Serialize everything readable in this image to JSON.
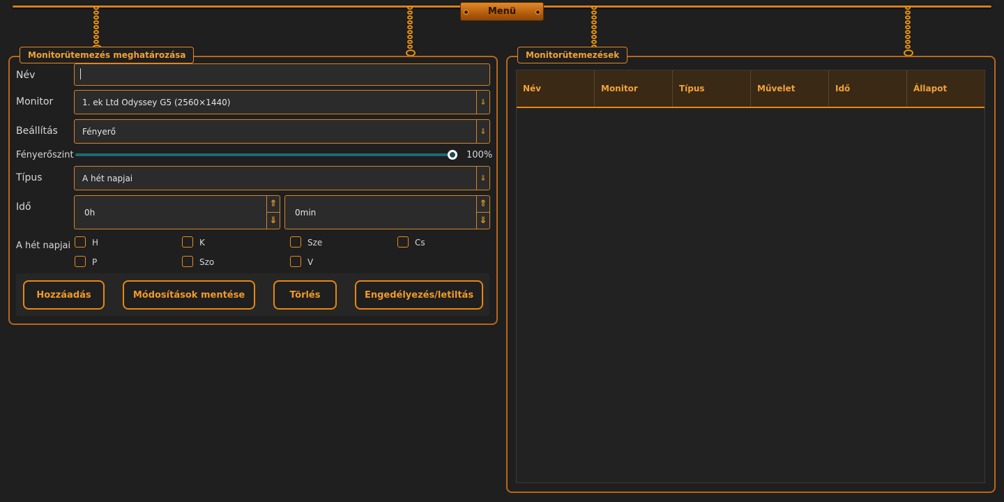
{
  "menu": {
    "label": "Menü"
  },
  "definition_panel": {
    "title": "Monitorütemezés meghatározása",
    "name_label": "Név",
    "name_value": "",
    "monitor_label": "Monitor",
    "monitor_value": "1. ek Ltd Odyssey G5 (2560×1440)",
    "setting_label": "Beállítás",
    "setting_value": "Fényerő",
    "brightness_label": "Fényerőszint",
    "brightness_value": "100%",
    "brightness_fraction": 1.0,
    "type_label": "Típus",
    "type_value": "A hét napjai",
    "time_label": "Idő",
    "hours_value": "0h",
    "minutes_value": "0min",
    "days_label": "A hét napjai",
    "days": [
      "H",
      "K",
      "Sze",
      "Cs",
      "P",
      "Szo",
      "V"
    ],
    "buttons": {
      "add": "Hozzáadás",
      "save": "Módosítások mentése",
      "delete": "Törlés",
      "toggle": "Engedélyezés/letiltás"
    }
  },
  "schedules_panel": {
    "title": "Monitorütemezések",
    "columns": [
      "Név",
      "Monitor",
      "Típus",
      "Művelet",
      "Idő",
      "Állapot"
    ],
    "rows": []
  },
  "colors": {
    "accent": "#e8880e",
    "background": "#1f1f1f",
    "slider": "#1e6a73"
  }
}
